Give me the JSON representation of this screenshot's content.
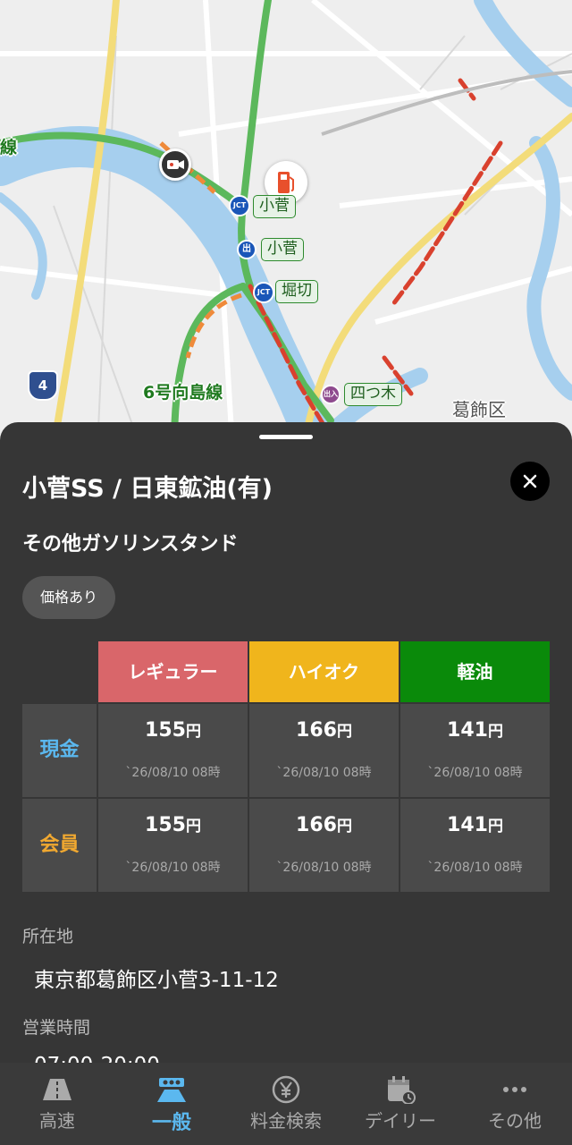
{
  "map": {
    "road_labels": {
      "route6": "6号向島線",
      "partial_left": "線"
    },
    "route_shield": "4",
    "ward_label": "葛飾区",
    "junctions": {
      "kosuge_jct": "小菅",
      "horikiri_jct": "堀切"
    },
    "exits": {
      "kosuge_exit": "小菅",
      "yotsugi_exit": "四つ木"
    },
    "badge_text": {
      "jct": "JCT",
      "exit": "出",
      "exit_in": "出入"
    },
    "icons": [
      "gas-station-icon",
      "camera-icon"
    ]
  },
  "station": {
    "name": "小菅SS / 日東鉱油(有)",
    "category": "その他ガソリンスタンド",
    "chip": "価格あり",
    "close_icon": "close-icon"
  },
  "prices": {
    "fuels": [
      {
        "label": "レギュラー",
        "color": "#d9666a"
      },
      {
        "label": "ハイオク",
        "color": "#f0b51c"
      },
      {
        "label": "軽油",
        "color": "#0a8a0a"
      }
    ],
    "rows": [
      {
        "label": "現金",
        "label_color": "#5bb8ef",
        "cells": [
          {
            "price": "155",
            "unit": "円",
            "time": "`26/08/10 08時"
          },
          {
            "price": "166",
            "unit": "円",
            "time": "`26/08/10 08時"
          },
          {
            "price": "141",
            "unit": "円",
            "time": "`26/08/10 08時"
          }
        ]
      },
      {
        "label": "会員",
        "label_color": "#f0a830",
        "cells": [
          {
            "price": "155",
            "unit": "円",
            "time": "`26/08/10 08時"
          },
          {
            "price": "166",
            "unit": "円",
            "time": "`26/08/10 08時"
          },
          {
            "price": "141",
            "unit": "円",
            "time": "`26/08/10 08時"
          }
        ]
      }
    ]
  },
  "details": {
    "address_label": "所在地",
    "address": "東京都葛飾区小菅3-11-12",
    "hours_label": "営業時間",
    "hours": "07:00-20:00"
  },
  "nav": {
    "items": [
      {
        "label": "高速",
        "icon": "highway-icon",
        "active": false
      },
      {
        "label": "一般",
        "icon": "road-icon",
        "active": true
      },
      {
        "label": "料金検索",
        "icon": "yen-icon",
        "active": false
      },
      {
        "label": "デイリー",
        "icon": "calendar-icon",
        "active": false
      },
      {
        "label": "その他",
        "icon": "more-icon",
        "active": false
      }
    ]
  }
}
